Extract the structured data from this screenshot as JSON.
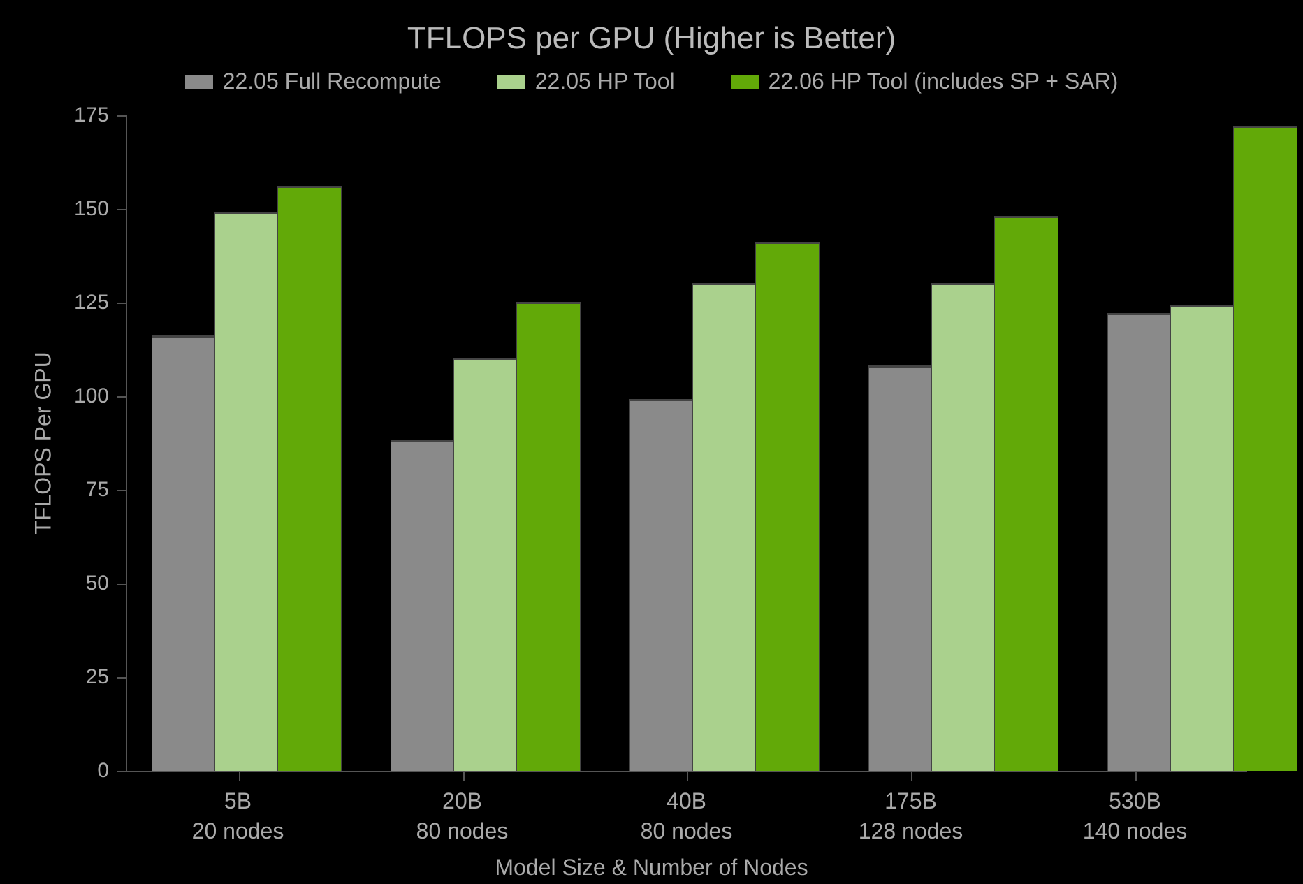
{
  "chart_data": {
    "type": "bar",
    "title": "TFLOPS per GPU (Higher is Better)",
    "xlabel": "Model Size & Number of Nodes",
    "ylabel": "TFLOPS Per GPU",
    "ylim": [
      0,
      175
    ],
    "yticks": [
      0,
      25,
      50,
      75,
      100,
      125,
      150,
      175
    ],
    "categories": [
      "5B\n20 nodes",
      "20B\n80 nodes",
      "40B\n80 nodes",
      "175B\n128 nodes",
      "530B\n140 nodes"
    ],
    "series": [
      {
        "name": "22.05 Full Recompute",
        "color": "#8a8a8a",
        "values": [
          116,
          88,
          99,
          108,
          122
        ]
      },
      {
        "name": "22.05 HP Tool",
        "color": "#aad18d",
        "values": [
          149,
          110,
          130,
          130,
          124
        ]
      },
      {
        "name": "22.06 HP Tool (includes SP + SAR)",
        "color": "#62a908",
        "values": [
          156,
          125,
          141,
          148,
          172
        ]
      }
    ],
    "legend_position": "top",
    "grid": false
  }
}
